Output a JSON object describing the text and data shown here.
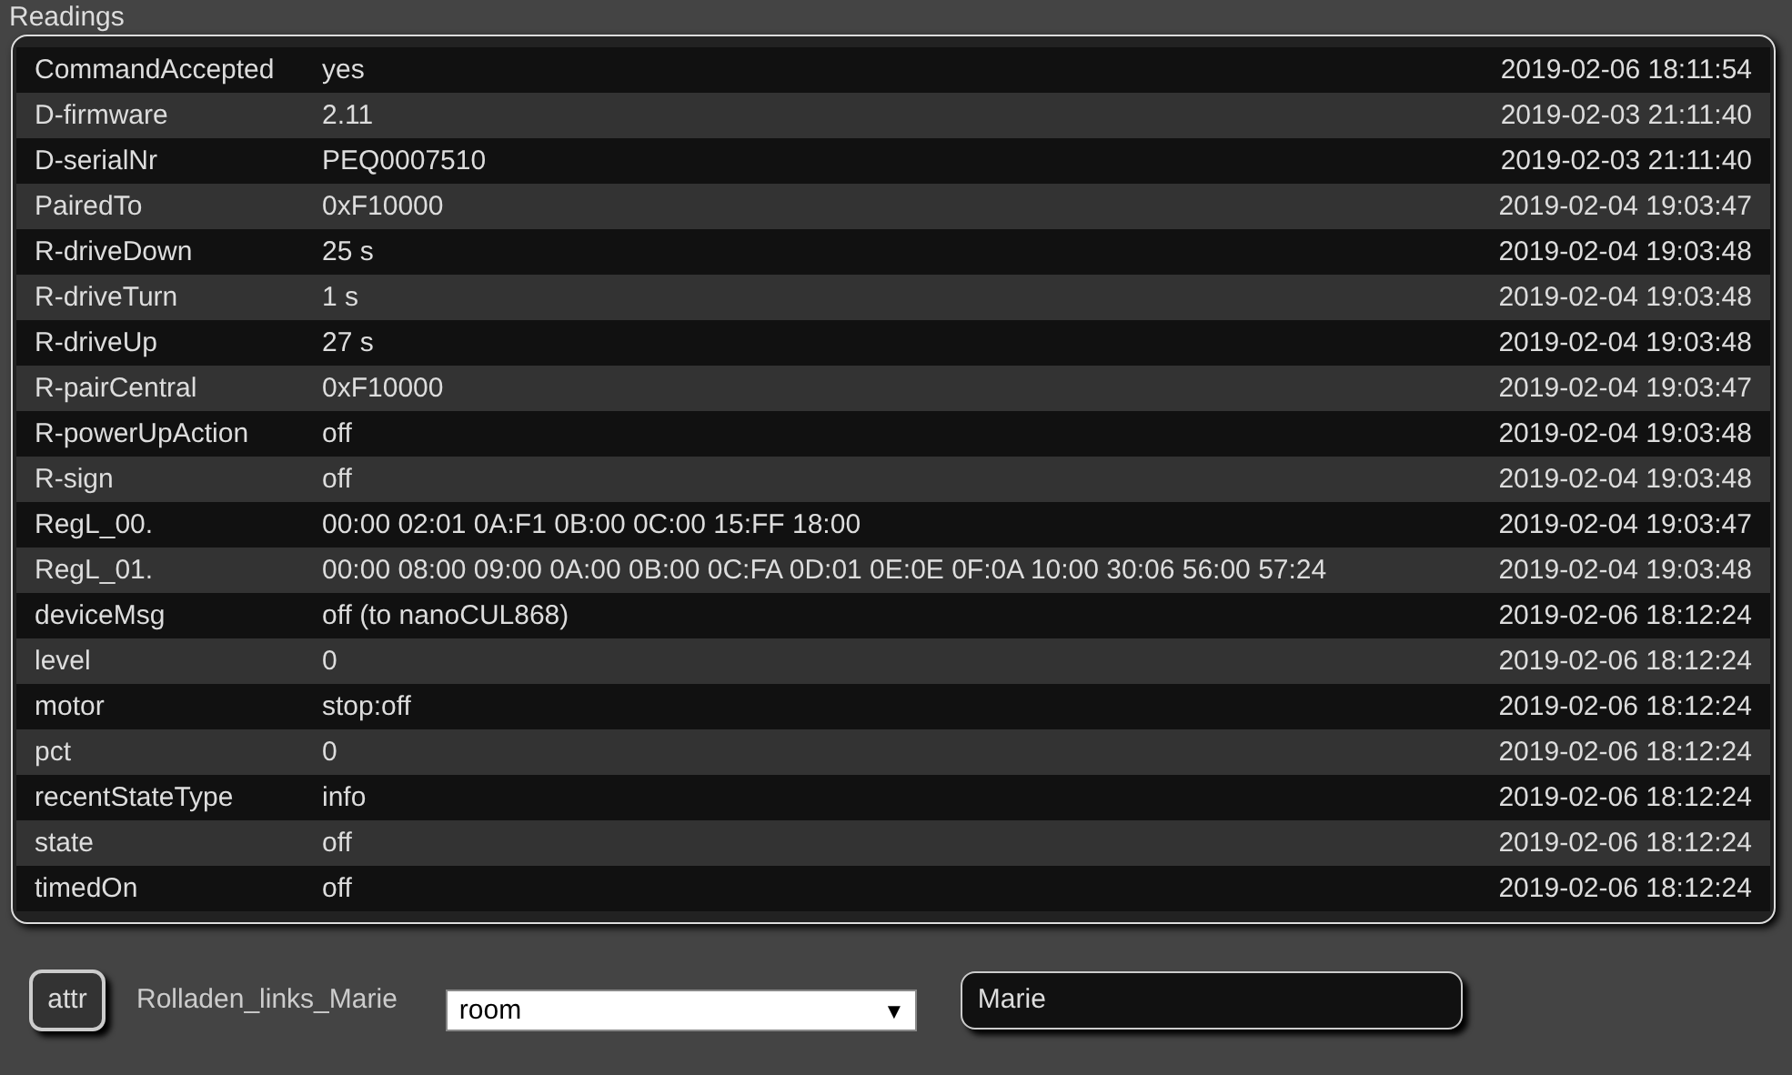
{
  "section_title": "Readings",
  "readings": [
    {
      "name": "CommandAccepted",
      "value": "yes",
      "time": "2019-02-06 18:11:54"
    },
    {
      "name": "D-firmware",
      "value": "2.11",
      "time": "2019-02-03 21:11:40"
    },
    {
      "name": "D-serialNr",
      "value": "PEQ0007510",
      "time": "2019-02-03 21:11:40"
    },
    {
      "name": "PairedTo",
      "value": "0xF10000",
      "time": "2019-02-04 19:03:47"
    },
    {
      "name": "R-driveDown",
      "value": "25 s",
      "time": "2019-02-04 19:03:48"
    },
    {
      "name": "R-driveTurn",
      "value": "1 s",
      "time": "2019-02-04 19:03:48"
    },
    {
      "name": "R-driveUp",
      "value": "27 s",
      "time": "2019-02-04 19:03:48"
    },
    {
      "name": "R-pairCentral",
      "value": "0xF10000",
      "time": "2019-02-04 19:03:47"
    },
    {
      "name": "R-powerUpAction",
      "value": "off",
      "time": "2019-02-04 19:03:48"
    },
    {
      "name": "R-sign",
      "value": "off",
      "time": "2019-02-04 19:03:48"
    },
    {
      "name": "RegL_00.",
      "value": "00:00 02:01 0A:F1 0B:00 0C:00 15:FF 18:00",
      "time": "2019-02-04 19:03:47"
    },
    {
      "name": "RegL_01.",
      "value": "00:00 08:00 09:00 0A:00 0B:00 0C:FA 0D:01 0E:0E 0F:0A 10:00 30:06 56:00 57:24",
      "time": "2019-02-04 19:03:48"
    },
    {
      "name": "deviceMsg",
      "value": "off (to nanoCUL868)",
      "time": "2019-02-06 18:12:24"
    },
    {
      "name": "level",
      "value": "0",
      "time": "2019-02-06 18:12:24"
    },
    {
      "name": "motor",
      "value": "stop:off",
      "time": "2019-02-06 18:12:24"
    },
    {
      "name": "pct",
      "value": "0",
      "time": "2019-02-06 18:12:24"
    },
    {
      "name": "recentStateType",
      "value": "info",
      "time": "2019-02-06 18:12:24"
    },
    {
      "name": "state",
      "value": "off",
      "time": "2019-02-06 18:12:24"
    },
    {
      "name": "timedOn",
      "value": "off",
      "time": "2019-02-06 18:12:24"
    }
  ],
  "attr_form": {
    "button": "attr",
    "device": "Rolladen_links_Marie",
    "attribute_select": {
      "value": "room",
      "arrow": "▼"
    },
    "value_field": {
      "value": "Marie"
    }
  }
}
